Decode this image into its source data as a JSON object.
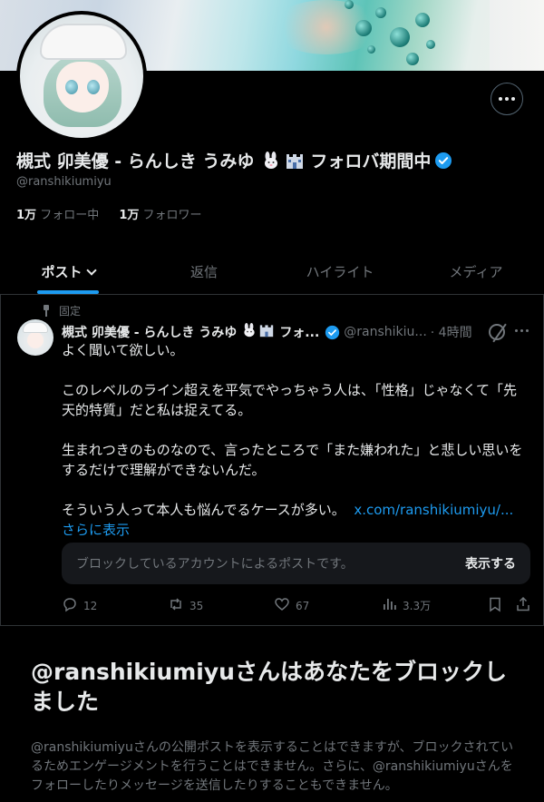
{
  "profile": {
    "display_name": "槻式 卯美優 - らんしき うみゆ",
    "name_suffix": "フォロバ期間中",
    "handle": "@ranshikiumiyu",
    "following_count": "1万",
    "following_label": "フォロー中",
    "followers_count": "1万",
    "followers_label": "フォロワー"
  },
  "tabs": [
    {
      "label": "ポスト"
    },
    {
      "label": "返信"
    },
    {
      "label": "ハイライト"
    },
    {
      "label": "メディア"
    }
  ],
  "pinned_post": {
    "pinned_label": "固定",
    "author_name": "槻式 卯美優 - らんしき うみゆ",
    "author_name_ellipsis": "フォ...",
    "handle": "@ranshikiu...",
    "time": "· 4時間",
    "paragraphs": [
      "よく聞いて欲しい。",
      "このレベルのライン超えを平気でやっちゃう人は、「性格」じゃなくて「先天的特質」だと私は捉えてる。",
      "生まれつきのものなので、言ったところで「また嫌われた」と悲しい思いをするだけで理解ができないんだ。"
    ],
    "last_paragraph": "そういう人って本人も悩んでるケースが多い。",
    "link_text": "x.com/ranshikiumiyu/...",
    "show_more": "さらに表示",
    "blocked_notice": "ブロックしているアカウントによるポストです。",
    "show_button": "表示する",
    "stats": {
      "replies": "12",
      "reposts": "35",
      "likes": "67",
      "views": "3.3万"
    }
  },
  "block_notice": {
    "title": "@ranshikiumiyuさんはあなたをブロックしました",
    "description": "@ranshikiumiyuさんの公開ポストを表示することはできますが、ブロックされているためエンゲージメントを行うことはできません。さらに、@ranshikiumiyuさんをフォローしたりメッセージを送信したりすることもできません。"
  },
  "colors": {
    "accent": "#1d9bf0",
    "text_primary": "#e7e9ea",
    "text_secondary": "#71767b",
    "border": "#2f3336"
  }
}
